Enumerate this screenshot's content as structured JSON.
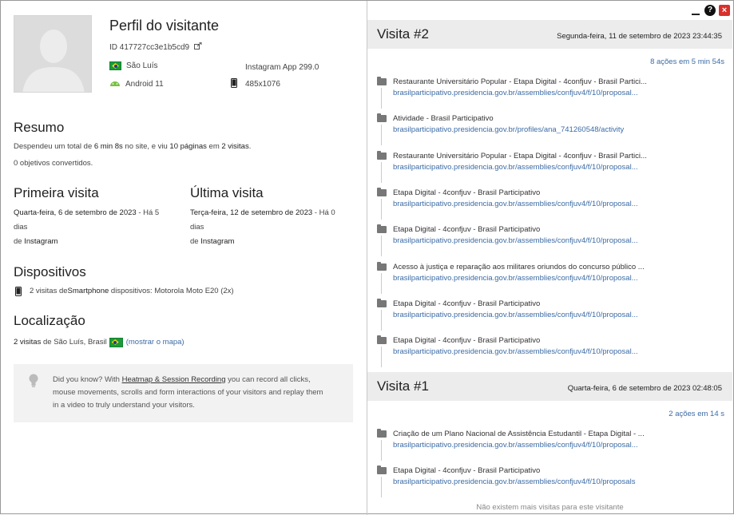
{
  "profile": {
    "title": "Perfil do visitante",
    "id_text": "ID 417727cc3e1b5cd9",
    "city": "São Luís",
    "browser": "Instagram App 299.0",
    "os": "Android 11",
    "resolution": "485x1076"
  },
  "summary": {
    "heading": "Resumo",
    "line1_pre": "Despendeu um total de ",
    "line1_time": "6 min 8s",
    "line1_mid": " no site, e viu ",
    "line1_pages": "10 páginas",
    "line1_mid2": " em ",
    "line1_visits": "2 visitas",
    "line1_end": ".",
    "line2": "0 objetivos convertidos."
  },
  "first_visit": {
    "heading": "Primeira visita",
    "date": "Quarta-feira, 6 de setembro de 2023",
    "ago_line1": " - Há 5",
    "ago_line2": "dias",
    "source_pre": "de ",
    "source": "Instagram"
  },
  "last_visit": {
    "heading": "Última visita",
    "date": "Terça-feira, 12 de setembro de 2023",
    "ago_line1": " - Há 0",
    "ago_line2": "dias",
    "source_pre": "de ",
    "source": "Instagram"
  },
  "devices": {
    "heading": "Dispositivos",
    "count": "2 visitas de ",
    "type": "Smartphone",
    "mid": " dispositivos: ",
    "model": "Motorola Moto E20 (2x)"
  },
  "location": {
    "heading": "Localização",
    "count": "2 visitas",
    "mid": " de ",
    "place": "São Luís, Brasil",
    "map_link": "(mostrar o mapa)"
  },
  "tip": {
    "pre": "Did you know? With ",
    "link": "Heatmap & Session Recording",
    "post": " you can record all clicks, mouse movements, scrolls and form interactions of your visitors and replay them in a video to truly understand your visitors."
  },
  "visits": [
    {
      "title": "Visita #2",
      "date": "Segunda-feira, 11 de setembro de 2023 23:44:35",
      "actions_summary": "8 ações em 5 min 54s",
      "actions": [
        {
          "title": "Restaurante Universitário Popular - Etapa Digital - 4confjuv - Brasil Partici...",
          "url": "brasilparticipativo.presidencia.gov.br/assemblies/confjuv4/f/10/proposal..."
        },
        {
          "title": "Atividade - Brasil Participativo",
          "url": "brasilparticipativo.presidencia.gov.br/profiles/ana_741260548/activity"
        },
        {
          "title": "Restaurante Universitário Popular - Etapa Digital - 4confjuv - Brasil Partici...",
          "url": "brasilparticipativo.presidencia.gov.br/assemblies/confjuv4/f/10/proposal..."
        },
        {
          "title": "Etapa Digital - 4confjuv - Brasil Participativo",
          "url": "brasilparticipativo.presidencia.gov.br/assemblies/confjuv4/f/10/proposal..."
        },
        {
          "title": "Etapa Digital - 4confjuv - Brasil Participativo",
          "url": "brasilparticipativo.presidencia.gov.br/assemblies/confjuv4/f/10/proposal..."
        },
        {
          "title": "Acesso à justiça e reparação aos militares oriundos do concurso público ...",
          "url": "brasilparticipativo.presidencia.gov.br/assemblies/confjuv4/f/10/proposal..."
        },
        {
          "title": "Etapa Digital - 4confjuv - Brasil Participativo",
          "url": "brasilparticipativo.presidencia.gov.br/assemblies/confjuv4/f/10/proposal..."
        },
        {
          "title": "Etapa Digital - 4confjuv - Brasil Participativo",
          "url": "brasilparticipativo.presidencia.gov.br/assemblies/confjuv4/f/10/proposal..."
        }
      ]
    },
    {
      "title": "Visita #1",
      "date": "Quarta-feira, 6 de setembro de 2023 02:48:05",
      "actions_summary": "2 ações em 14 s",
      "actions": [
        {
          "title": "Criação de um Plano Nacional de Assistência Estudantil - Etapa Digital - ...",
          "url": "brasilparticipativo.presidencia.gov.br/assemblies/confjuv4/f/10/proposal..."
        },
        {
          "title": "Etapa Digital - 4confjuv - Brasil Participativo",
          "url": "brasilparticipativo.presidencia.gov.br/assemblies/confjuv4/f/10/proposals"
        }
      ]
    }
  ],
  "no_more": "Não existem mais visitas para este visitante",
  "window": {
    "help": "?",
    "close": "×"
  }
}
